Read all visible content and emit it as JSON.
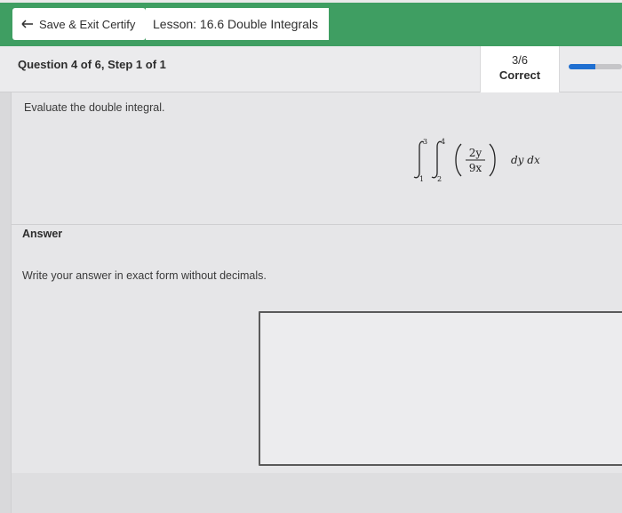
{
  "header": {
    "exit_label": "Save & Exit Certify",
    "lesson_label": "Lesson: 16.6 Double Integrals"
  },
  "question": {
    "title": "Question 4 of 6, Step 1 of 1",
    "score": "3/6",
    "status": "Correct",
    "progress_fraction": 0.5
  },
  "prompt": "Evaluate the double integral.",
  "integral": {
    "outer_upper": "3",
    "outer_lower": "1",
    "inner_upper": "4",
    "inner_lower": "2",
    "numerator": "2y",
    "denominator": "9x",
    "differentials": "dy dx"
  },
  "answer": {
    "label": "Answer",
    "instructions": "Write your answer in exact form without decimals.",
    "value": ""
  },
  "colors": {
    "header_green": "#3f9e62",
    "progress_blue": "#1f6fd1"
  }
}
